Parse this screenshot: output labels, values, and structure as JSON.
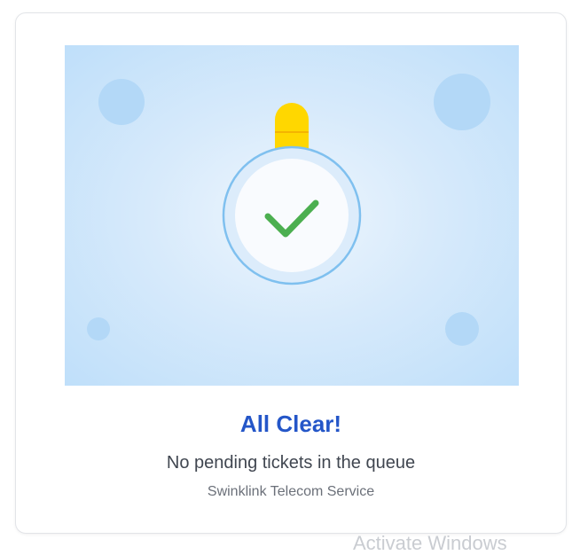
{
  "empty_state": {
    "title": "All Clear!",
    "subtitle": "No pending tickets in the queue",
    "service_name": "Swinklink Telecom Service",
    "illustration_icon": "stopwatch-check-icon"
  },
  "os_watermark": {
    "text": "Activate Windows"
  },
  "colors": {
    "title": "#2456c8",
    "check": "#4caf50",
    "stopwatch_cap": "#ffd700",
    "illustration_bg": "#d7eafb"
  }
}
